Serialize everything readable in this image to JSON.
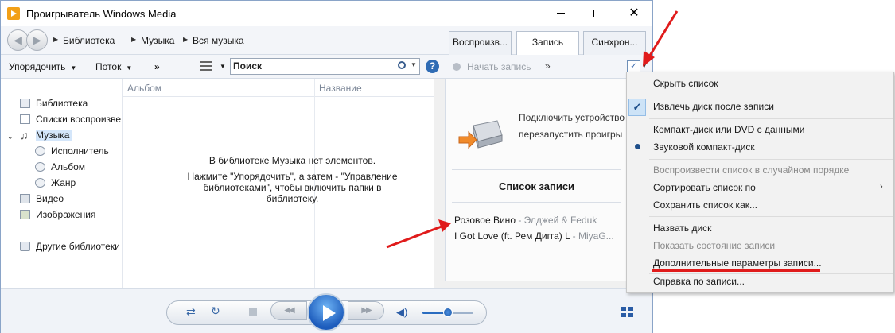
{
  "window": {
    "title": "Проигрыватель Windows Media"
  },
  "nav": {
    "breadcrumb": [
      "Библиотека",
      "Музыка",
      "Вся музыка"
    ],
    "tabs": [
      {
        "label": "Воспроизв...",
        "active": false
      },
      {
        "label": "Запись",
        "active": true
      },
      {
        "label": "Синхрон...",
        "active": false
      }
    ]
  },
  "toolbar": {
    "organize": "Упорядочить",
    "stream": "Поток",
    "more": "»",
    "search_placeholder": "Поиск",
    "burn_start": "Начать запись",
    "burn_more": "»"
  },
  "sidebar": {
    "items": [
      {
        "label": "Библиотека",
        "icon": "library-icon"
      },
      {
        "label": "Списки воспроизве",
        "icon": "playlist-icon"
      },
      {
        "label": "Музыка",
        "icon": "music-icon",
        "selected": true
      },
      {
        "label": "Исполнитель",
        "icon": "artist-icon"
      },
      {
        "label": "Альбом",
        "icon": "album-icon"
      },
      {
        "label": "Жанр",
        "icon": "genre-icon"
      },
      {
        "label": "Видео",
        "icon": "video-icon"
      },
      {
        "label": "Изображения",
        "icon": "pictures-icon"
      },
      {
        "label": "Другие библиотеки",
        "icon": "other-libraries-icon"
      }
    ]
  },
  "library": {
    "columns": [
      "Альбом",
      "Название"
    ],
    "empty_message_lines": [
      "В библиотеке Музыка нет элементов.",
      "Нажмите \"Упорядочить\", а затем - \"Управление",
      "библиотеками\", чтобы включить папки в",
      "библиотеку."
    ]
  },
  "burn": {
    "tip_lines": [
      "Подключить устройство",
      "перезапустить проигры"
    ],
    "list_title": "Список записи",
    "tracks": [
      {
        "title": "Розовое Вино",
        "artist": " - Элджей & Feduk"
      },
      {
        "title": "I Got Love (ft. Рем Дигга) L",
        "artist": " - MiyaG..."
      }
    ]
  },
  "menu": {
    "items": [
      {
        "label": "Скрыть список",
        "disabled": false
      },
      {
        "label": "Извлечь диск после записи",
        "disabled": false,
        "checked": true
      },
      {
        "label": "Компакт-диск или DVD с данными",
        "disabled": false
      },
      {
        "label": "Звуковой компакт-диск",
        "disabled": false,
        "radio": true
      },
      {
        "label": "Воспроизвести список в случайном порядке",
        "disabled": true
      },
      {
        "label": "Сортировать список по",
        "disabled": false,
        "submenu": true
      },
      {
        "label": "Сохранить список как...",
        "disabled": false
      },
      {
        "label": "Назвать диск",
        "disabled": false
      },
      {
        "label": "Показать состояние записи",
        "disabled": true
      },
      {
        "label": "Дополнительные параметры записи...",
        "disabled": false,
        "highlighted": true
      },
      {
        "label": "Справка по записи...",
        "disabled": false
      }
    ]
  },
  "colors": {
    "accent": "#2a5ca6",
    "annotation": "#e01b1b"
  },
  "transport": {
    "volume_level": 0.45
  }
}
